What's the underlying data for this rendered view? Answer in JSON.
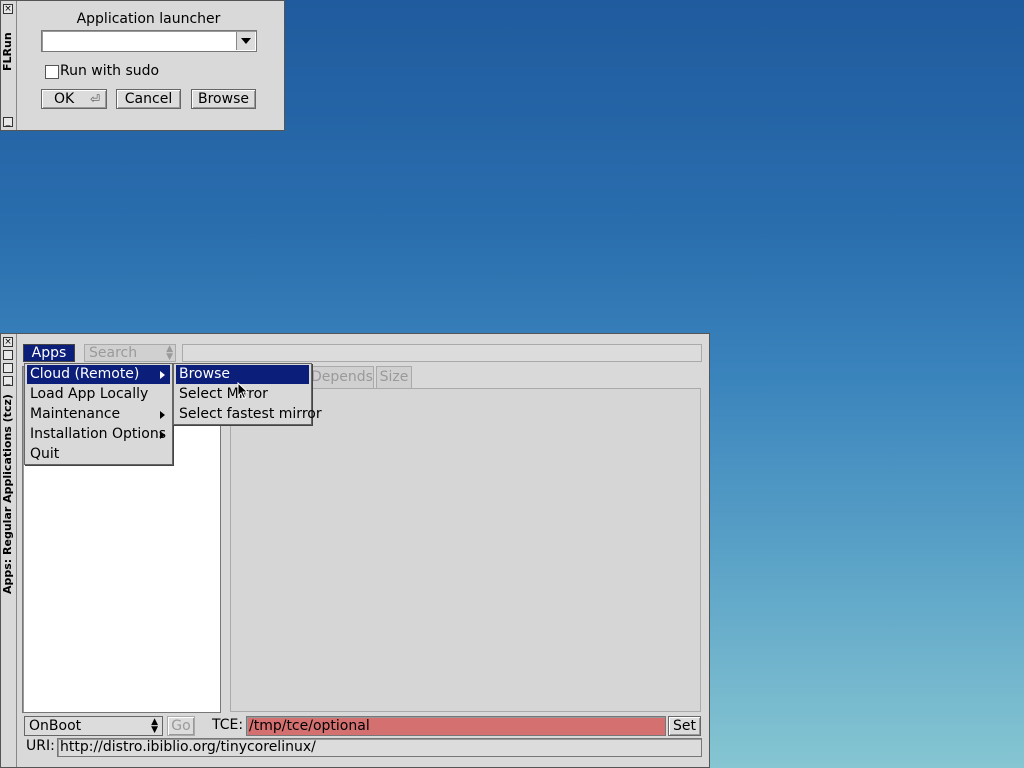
{
  "flrun": {
    "window_title": "FLRun",
    "heading": "Application launcher",
    "command_value": "",
    "sudo_label": "Run with sudo",
    "ok_label": "OK",
    "cancel_label": "Cancel",
    "browse_label": "Browse"
  },
  "apps": {
    "window_title": "Apps: Regular Applications (tcz)",
    "apps_menu_label": "Apps",
    "search_mode": "Search",
    "search_value": "",
    "tabs": [
      "Depends",
      "Size"
    ],
    "apps_menu": [
      {
        "label": "Cloud (Remote)",
        "submenu": true
      },
      {
        "label": "Load App Locally",
        "submenu": false
      },
      {
        "label": "Maintenance",
        "submenu": true
      },
      {
        "label": "Installation Options",
        "submenu": true
      },
      {
        "label": "Quit",
        "submenu": false
      }
    ],
    "cloud_submenu": [
      {
        "label": "Browse"
      },
      {
        "label": "Select Mirror"
      },
      {
        "label": "Select fastest mirror"
      }
    ],
    "onboot_value": "OnBoot",
    "go_label": "Go",
    "tce_label": "TCE:",
    "tce_value": "/tmp/tce/optional",
    "set_label": "Set",
    "uri_label": "URI:",
    "uri_value": "http://distro.ibiblio.org/tinycorelinux/"
  },
  "colors": {
    "menu_highlight": "#0b1e7a",
    "tce_field": "#d47070"
  }
}
